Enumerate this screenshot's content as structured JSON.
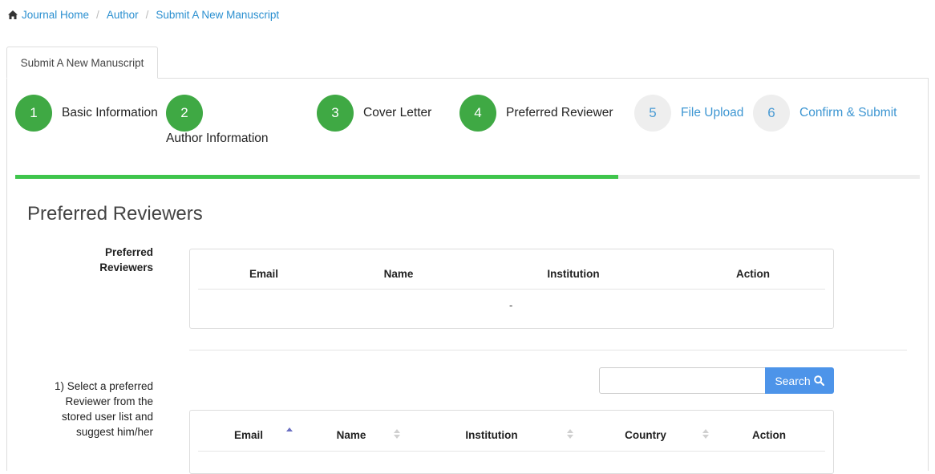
{
  "breadcrumb": {
    "home": "Journal Home",
    "author": "Author",
    "current": "Submit A New Manuscript",
    "separator": "/"
  },
  "tab": {
    "label": "Submit A New Manuscript"
  },
  "steps": [
    {
      "number": "1",
      "label": "Basic Information",
      "status": "complete"
    },
    {
      "number": "2",
      "label": "Author Information",
      "status": "complete"
    },
    {
      "number": "3",
      "label": "Cover Letter",
      "status": "complete"
    },
    {
      "number": "4",
      "label": "Preferred Reviewer",
      "status": "current"
    },
    {
      "number": "5",
      "label": "File Upload",
      "status": "pending"
    },
    {
      "number": "6",
      "label": "Confirm & Submit",
      "status": "pending"
    }
  ],
  "progress": {
    "fraction": 0.667
  },
  "section": {
    "title": "Preferred Reviewers"
  },
  "preferred_table": {
    "label_line1": "Preferred",
    "label_line2": "Reviewers",
    "headers": [
      "Email",
      "Name",
      "Institution",
      "Action"
    ],
    "empty_text": "-"
  },
  "select_section": {
    "label_lines": [
      "1) Select a preferred",
      "Reviewer from the",
      "stored user list and",
      "suggest him/her"
    ],
    "search_placeholder": "",
    "search_button": "Search",
    "headers": [
      "Email",
      "Name",
      "Institution",
      "Country",
      "Action"
    ],
    "sort_state": [
      "asc",
      "both",
      "both",
      "both",
      "none"
    ]
  },
  "colors": {
    "step_complete": "#3fa944",
    "step_pending_bg": "#eeeeee",
    "link": "#2a8fd0",
    "progress": "#3fc54c",
    "search_button": "#4d94e9"
  },
  "icons": {
    "home": "home-icon",
    "search": "search-icon",
    "sort": "sort-icon"
  }
}
